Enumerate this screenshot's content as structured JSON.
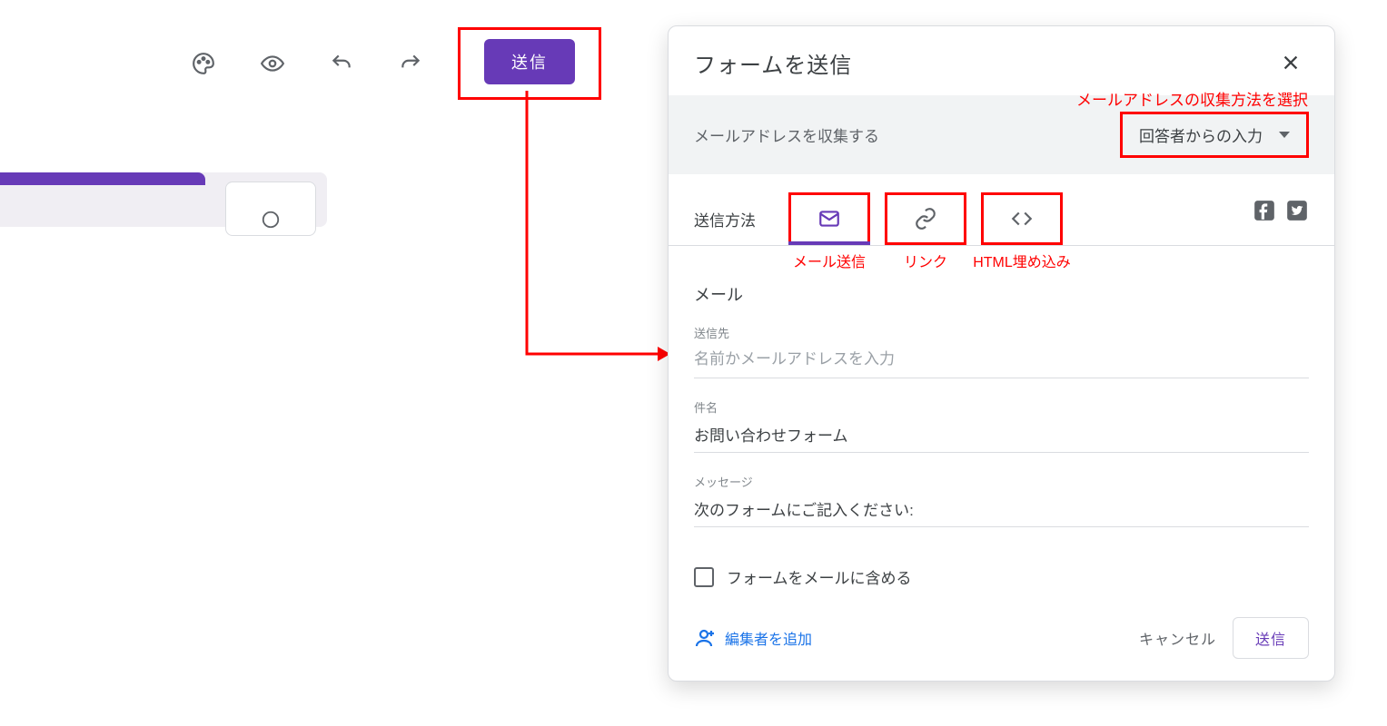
{
  "toolbar": {
    "send_button": "送信"
  },
  "annotations": {
    "dropdown_hint": "メールアドレスの収集方法を選択",
    "tab_email": "メール送信",
    "tab_link": "リンク",
    "tab_embed": "HTML埋め込み"
  },
  "dialog": {
    "title": "フォームを送信",
    "collect_label": "メールアドレスを収集する",
    "collect_selected": "回答者からの入力",
    "method_label": "送信方法",
    "section_title": "メール",
    "fields": {
      "to_label": "送信先",
      "to_placeholder": "名前かメールアドレスを入力",
      "to_value": "",
      "subject_label": "件名",
      "subject_value": "お問い合わせフォーム",
      "message_label": "メッセージ",
      "message_value": "次のフォームにご記入ください:"
    },
    "checkbox_label": "フォームをメールに含める",
    "add_editors": "編集者を追加",
    "cancel": "キャンセル",
    "submit": "送信"
  }
}
